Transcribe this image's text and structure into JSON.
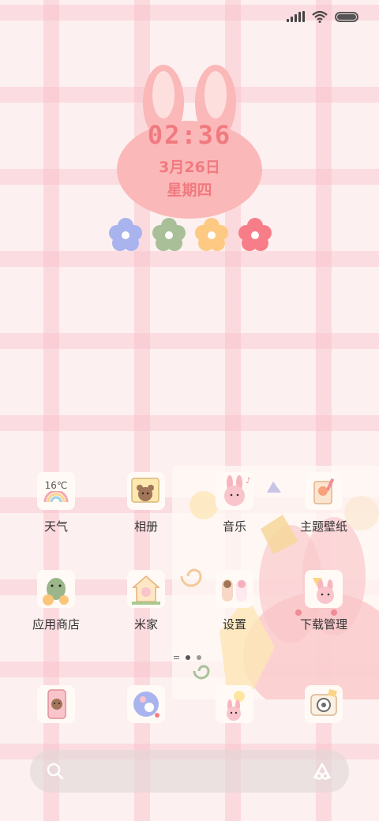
{
  "status_bar": {
    "signal_icon": "signal-bars-icon",
    "wifi_icon": "wifi-icon",
    "battery_icon": "battery-icon",
    "battery_level": 1.0
  },
  "clock_widget": {
    "time": "02:36",
    "date": "3月26日",
    "weekday": "星期四",
    "colors": {
      "bunny": "#fbb8b8",
      "text": "#f07a80"
    },
    "flowers": [
      {
        "name": "purple-flower-icon",
        "color": "#a9b4ee"
      },
      {
        "name": "green-flower-icon",
        "color": "#a8bf98"
      },
      {
        "name": "yellow-flower-icon",
        "color": "#fdc983"
      },
      {
        "name": "pink-flower-icon",
        "color": "#f77e88"
      }
    ]
  },
  "apps": {
    "weather": {
      "label": "天气",
      "icon_text": "16℃",
      "icon": "weather-icon"
    },
    "gallery": {
      "label": "相册",
      "icon": "bear-photo-icon"
    },
    "music": {
      "label": "音乐",
      "icon": "bunny-music-icon"
    },
    "themes": {
      "label": "主题壁纸",
      "icon": "drink-theme-icon"
    },
    "app_store": {
      "label": "应用商店",
      "icon": "dino-store-icon"
    },
    "mi_home": {
      "label": "米家",
      "icon": "house-icon"
    },
    "settings": {
      "label": "设置",
      "icon": "settings-icon"
    },
    "downloads": {
      "label": "下载管理",
      "icon": "bunny-download-icon"
    }
  },
  "dock": [
    {
      "icon": "phone-icon"
    },
    {
      "icon": "messages-icon"
    },
    {
      "icon": "browser-icon"
    },
    {
      "icon": "camera-icon"
    }
  ],
  "search_bar": {
    "search_icon": "search-icon",
    "assistant_icon": "assistant-icon"
  }
}
